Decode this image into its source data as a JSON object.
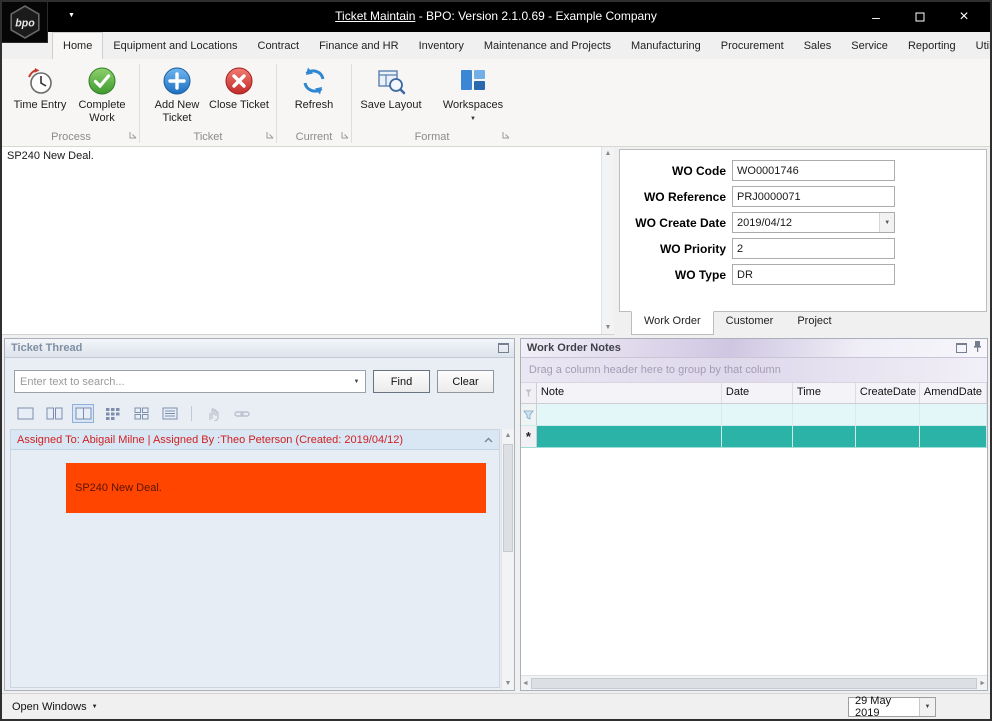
{
  "icons": {
    "up_arrow": "▲",
    "down_arrow": "▼",
    "left_arrow": "◄",
    "right_arrow": "►",
    "dropdown": "▼",
    "minimize": "–",
    "close": "×",
    "asterisk": "*"
  },
  "titlebar": {
    "logo_text": "bpo",
    "title_document": "Ticket Maintain",
    "title_suffix": " - BPO: Version 2.1.0.69 - Example Company"
  },
  "ribbon": {
    "tabs": [
      "Home",
      "Equipment and Locations",
      "Contract",
      "Finance and HR",
      "Inventory",
      "Maintenance and Projects",
      "Manufacturing",
      "Procurement",
      "Sales",
      "Service",
      "Reporting",
      "Utilities"
    ],
    "selected_tab": "Home",
    "groups": [
      {
        "label": "Process",
        "buttons": [
          "Time Entry",
          "Complete Work"
        ]
      },
      {
        "label": "Ticket",
        "buttons": [
          "Add New Ticket",
          "Close Ticket"
        ]
      },
      {
        "label": "Current",
        "buttons": [
          "Refresh"
        ]
      },
      {
        "label": "Format",
        "buttons": [
          "Save Layout",
          "Workspaces"
        ]
      }
    ]
  },
  "ticket_editor": {
    "text": "SP240 New Deal."
  },
  "work_order": {
    "fields": [
      {
        "label": "WO Code",
        "value": "WO0001746"
      },
      {
        "label": "WO Reference",
        "value": "PRJ0000071"
      },
      {
        "label": "WO Create Date",
        "value": "2019/04/12"
      },
      {
        "label": "WO Priority",
        "value": "2"
      },
      {
        "label": "WO Type",
        "value": "DR"
      }
    ],
    "tabs": [
      "Work Order",
      "Customer",
      "Project"
    ],
    "selected_tab": "Work Order"
  },
  "ticket_thread": {
    "title": "Ticket Thread",
    "search_placeholder": "Enter text to search...",
    "find_label": "Find",
    "clear_label": "Clear",
    "message": {
      "header": "Assigned To: Abigail Milne | Assigned By :Theo Peterson (Created: 2019/04/12)",
      "body": "SP240 New Deal."
    }
  },
  "work_order_notes": {
    "title": "Work Order Notes",
    "group_hint": "Drag a column header here to group by that column",
    "columns": [
      "Note",
      "Date",
      "Time",
      "CreateDate",
      "AmendDate"
    ]
  },
  "statusbar": {
    "open_windows_label": "Open Windows",
    "date_value": "29 May 2019"
  },
  "colors": {
    "message_highlight": "#ff4500",
    "selected_row_teal": "#2bb3a8",
    "filter_row_cyan": "#e3f7f8",
    "assigned_text_red": "#d01f1f"
  }
}
